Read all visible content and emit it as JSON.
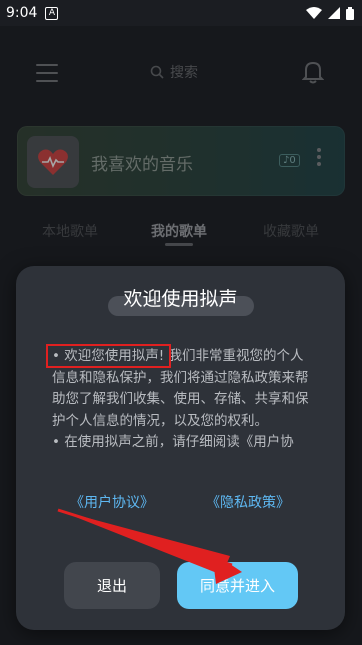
{
  "statusbar": {
    "time": "9:04",
    "notif_letter": "A"
  },
  "topbar": {
    "search_placeholder": "搜索"
  },
  "favorite": {
    "title": "我喜欢的音乐",
    "badge": "♪0"
  },
  "tabs": [
    {
      "label": "本地歌单"
    },
    {
      "label": "我的歌单"
    },
    {
      "label": "收藏歌单"
    }
  ],
  "dialog": {
    "title": "欢迎使用拟声",
    "highlight": "• 欢迎您使用拟声!",
    "para1_rest": " 我们非常重视您的个人信息和隐私保护，我们将通过隐私政策来帮助您了解我们收集、使用、存储、共享和保护个人信息的情况，以及您的权利。",
    "para2": "• 在使用拟声之前，请仔细阅读《用户协",
    "link_terms": "《用户协议》",
    "link_privacy": "《隐私政策》",
    "btn_exit": "退出",
    "btn_agree": "同意并进入"
  },
  "colors": {
    "accent": "#63c8f5",
    "link": "#5eb8f2",
    "annotation": "#e02020"
  }
}
